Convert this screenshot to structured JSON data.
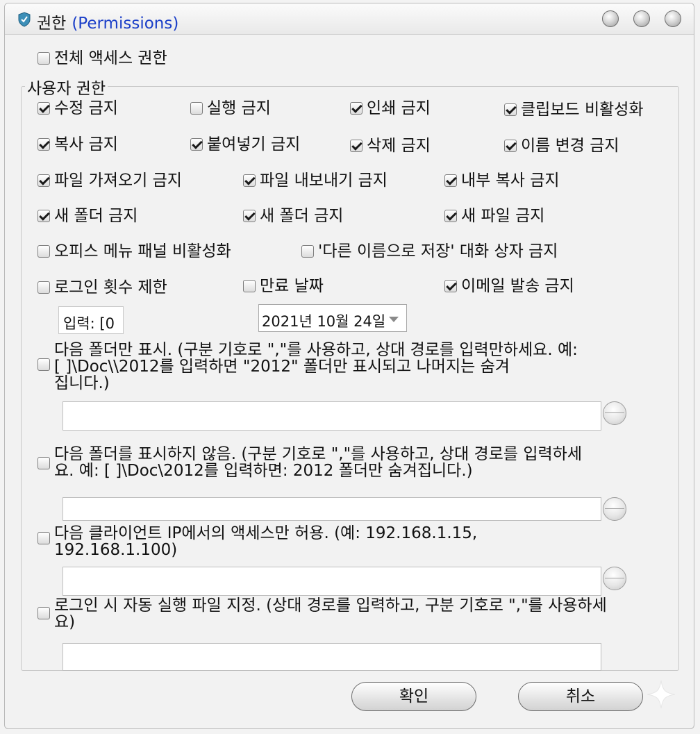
{
  "window": {
    "title": "권한",
    "title_sub": "(Permissions)"
  },
  "full_access": {
    "label": "전체 액세스 권한",
    "checked": false
  },
  "user_permissions": {
    "legend": "사용자 권한",
    "items": [
      {
        "label": "수정 금지",
        "checked": true
      },
      {
        "label": "실행 금지",
        "checked": false
      },
      {
        "label": "인쇄 금지",
        "checked": true
      },
      {
        "label": "클립보드 비활성화",
        "checked": true
      },
      {
        "label": "복사 금지",
        "checked": true
      },
      {
        "label": "붙여넣기 금지",
        "checked": true
      },
      {
        "label": "삭제 금지",
        "checked": true
      },
      {
        "label": "이름 변경 금지",
        "checked": true
      },
      {
        "label": "파일 가져오기 금지",
        "checked": true
      },
      {
        "label": "파일 내보내기 금지",
        "checked": true
      },
      {
        "label": "내부 복사 금지",
        "checked": true
      },
      {
        "label": "새 폴더 금지",
        "checked": true
      },
      {
        "label": "새 폴더 금지",
        "checked": true
      },
      {
        "label": "새 파일 금지",
        "checked": true
      },
      {
        "label": "오피스 메뉴 패널 비활성화",
        "checked": false
      },
      {
        "label": "'다른 이름으로 저장' 대화 상자 금지",
        "checked": false
      },
      {
        "label": "로그인 횟수 제한",
        "checked": false
      },
      {
        "label": "만료 날짜",
        "checked": false
      },
      {
        "label": "이메일 발송 금지",
        "checked": true
      }
    ],
    "login_count_input": "입력: [0",
    "expiry_date": "2021년 10월 24일"
  },
  "folder_options": [
    {
      "line1": "다음 폴더만 표시. (구분 기호로 \",\"를 사용하고, 상대 경로를 입력만하세요. 예:",
      "line2": "[  ]\\Doc\\\\2012를 입력하면 \"2012\" 폴더만 표시되고   나머지는 숨겨",
      "line3": "집니다.)",
      "checked": false,
      "value": ""
    },
    {
      "line1": "다음 폴더를 표시하지 않음. (구분 기호로 \",\"를 사용하고, 상대 경로를 입력하세",
      "line2": "요. 예: [ ]\\Doc\\2012를 입력하면: 2012 폴더만 숨겨집니다.)",
      "checked": false,
      "value": ""
    },
    {
      "line1": "다음 클라이언트 IP에서의 액세스만 허용. (예: 192.168.1.15,",
      "line2": "192.168.1.100)",
      "checked": false,
      "value": ""
    },
    {
      "line1": "로그인 시 자동 실행 파일 지정. (상대 경로를 입력하고, 구분 기호로 \",\"를 사용하세",
      "line2": "요)",
      "checked": false,
      "value": ""
    }
  ],
  "buttons": {
    "ok": "확인",
    "cancel": "취소"
  },
  "icons": [
    "shield-icon",
    "window-control-icon",
    "sparkle-icon"
  ]
}
